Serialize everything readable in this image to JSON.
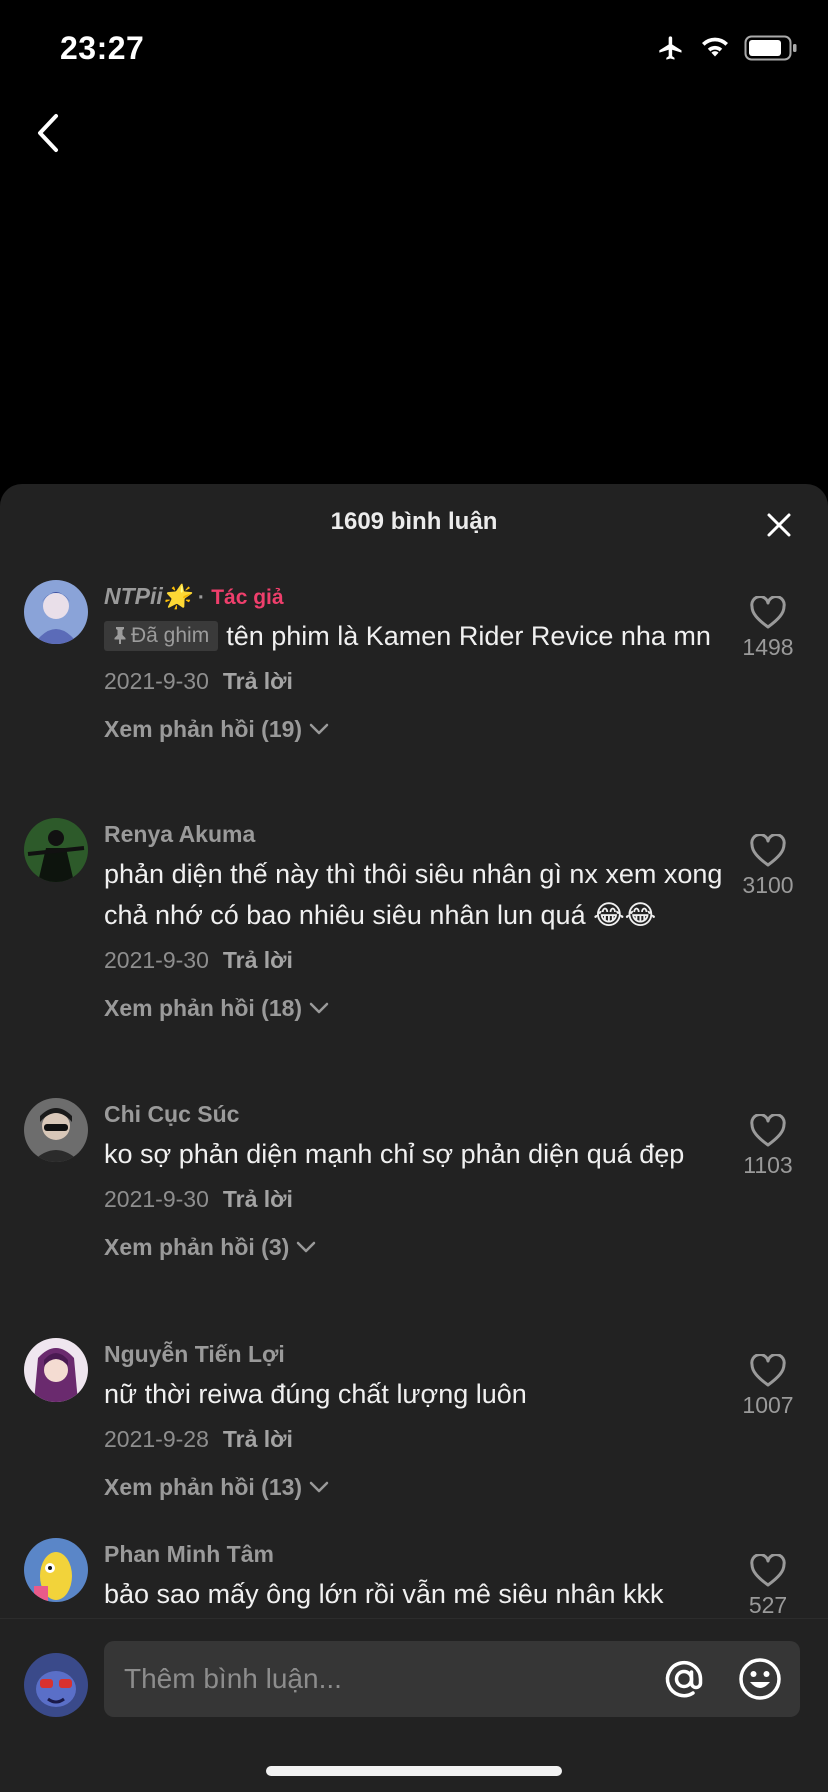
{
  "status_bar": {
    "time": "23:27",
    "icons": [
      "airplane-icon",
      "wifi-icon",
      "battery-icon"
    ]
  },
  "sheet": {
    "title": "1609 bình luận",
    "close_icon": "close-icon"
  },
  "comments": [
    {
      "username": "NTPii🌟",
      "author_sep": "·",
      "author_label": "Tác giả",
      "pinned_label": "Đã ghim",
      "text": "tên phim là Kamen Rider Revice nha mn",
      "date": "2021-9-30",
      "reply": "Trả lời",
      "view_replies": "Xem phản hồi (19)",
      "likes": "1498"
    },
    {
      "username": "Renya Akuma",
      "text": "phản diện thế này thì thôi siêu nhân gì nx xem xong chả nhớ có bao nhiêu siêu nhân lun quá 😂😂",
      "date": "2021-9-30",
      "reply": "Trả lời",
      "view_replies": "Xem phản hồi (18)",
      "likes": "3100"
    },
    {
      "username": "Chi Cục Súc",
      "text": "ko sợ phản diện mạnh chỉ sợ phản diện quá đẹp",
      "date": "2021-9-30",
      "reply": "Trả lời",
      "view_replies": "Xem phản hồi (3)",
      "likes": "1103"
    },
    {
      "username": "Nguyễn Tiến Lợi",
      "text": "nữ thời reiwa đúng chất lượng luôn",
      "date": "2021-9-28",
      "reply": "Trả lời",
      "view_replies": "Xem phản hồi (13)",
      "likes": "1007"
    },
    {
      "username": "Phan Minh Tâm",
      "text": "bảo sao mấy ông lớn rồi vẫn mê siêu nhân kkk",
      "likes": "527"
    }
  ],
  "composer": {
    "placeholder": "Thêm bình luận..."
  },
  "colors": {
    "sheet_bg": "#222222",
    "author_accent": "#ef3f6c",
    "input_bg": "#363636"
  }
}
